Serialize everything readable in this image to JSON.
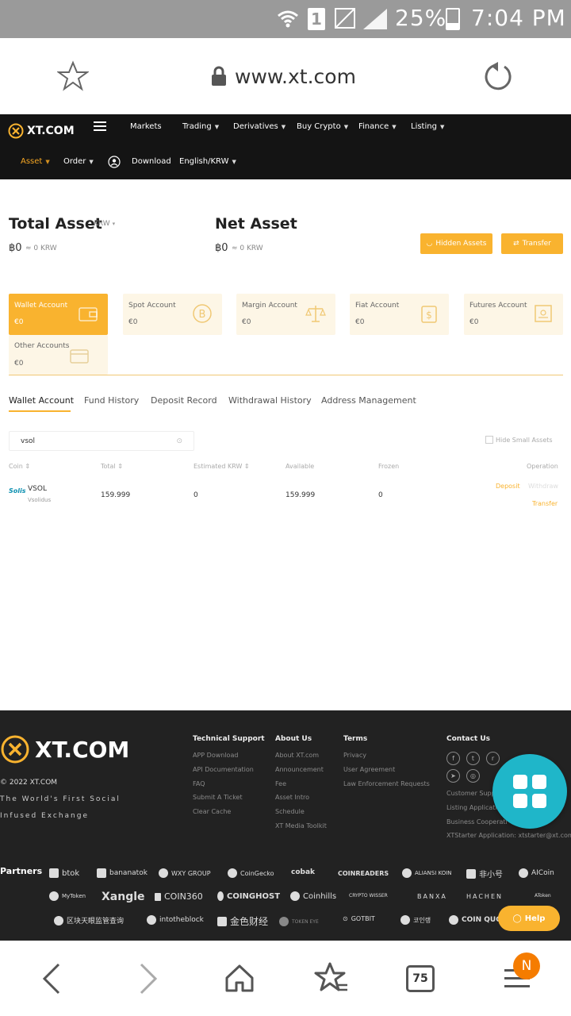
{
  "status_bar": {
    "battery": "25%",
    "time": "7:04 PM",
    "sim_label": "1"
  },
  "browser": {
    "url": "www.xt.com",
    "tabs_count": "75",
    "profile_initial": "N"
  },
  "header": {
    "logo": "XT.COM",
    "nav": [
      "Markets",
      "Trading",
      "Derivatives",
      "Buy Crypto",
      "Finance",
      "Listing"
    ],
    "subnav": [
      "Asset",
      "Order",
      "Download",
      "English/KRW"
    ]
  },
  "assets": {
    "total_title": "Total Asset",
    "total_currency": "KRW",
    "total_value": "฿0",
    "total_krw": "≈ 0 KRW",
    "net_title": "Net Asset",
    "net_value": "฿0",
    "net_krw": "≈ 0 KRW",
    "hidden_btn": "Hidden Assets",
    "transfer_btn": "Transfer"
  },
  "accounts": [
    {
      "label": "Wallet Account",
      "value": "€0"
    },
    {
      "label": "Spot Account",
      "value": "€0"
    },
    {
      "label": "Margin Account",
      "value": "€0"
    },
    {
      "label": "Fiat Account",
      "value": "€0"
    },
    {
      "label": "Futures Account",
      "value": "€0"
    },
    {
      "label": "Other Accounts",
      "value": "€0"
    }
  ],
  "tabs": [
    "Wallet Account",
    "Fund History",
    "Deposit Record",
    "Withdrawal History",
    "Address Management"
  ],
  "search": {
    "value": "vsol"
  },
  "hide_small": "Hide Small Assets",
  "table": {
    "headers": [
      "Coin",
      "Total",
      "Estimated KRW",
      "Available",
      "Frozen",
      "Operation"
    ],
    "rows": [
      {
        "coin": "VSOL",
        "name": "Vsolidus",
        "total": "159.999",
        "krw": "0",
        "available": "159.999",
        "frozen": "0",
        "deposit": "Deposit",
        "withdraw": "Withdraw",
        "transfer": "Transfer"
      }
    ]
  },
  "footer": {
    "logo": "XT.COM",
    "copyright": "© 2022 XT.COM",
    "slogan_1": "The World's First Social",
    "slogan_2": "Infused Exchange",
    "tech_title": "Technical Support",
    "tech": [
      "APP Download",
      "API Documentation",
      "FAQ",
      "Submit A Ticket",
      "Clear Cache"
    ],
    "about_title": "About Us",
    "about": [
      "About XT.com",
      "Announcement",
      "Fee",
      "Asset Intro",
      "Schedule",
      "XT Media Toolkit"
    ],
    "terms_title": "Terms",
    "terms": [
      "Privacy",
      "User Agreement",
      "Law Enforcement Requests"
    ],
    "contact_title": "Contact Us",
    "contact": [
      "Customer Supp",
      "Listing Applicati",
      "Business Cooperati",
      "XTStarter Application: xtstarter@xt.com"
    ],
    "partners_label": "Partners",
    "partners_row1": [
      "btok",
      "bananatok",
      "WXY GROUP",
      "CoinGecko",
      "cobak",
      "COINREADERS",
      "ALIANSI KOIN",
      "非小号",
      "AICoin"
    ],
    "partners_row2": [
      "MyToken",
      "Xangle",
      "COIN360",
      "COINGHOST",
      "Coinhills",
      "CRYPTO WISSER",
      "BANXA",
      "HACHEN",
      "AToken"
    ],
    "partners_row3": [
      "区块天眼监管查询",
      "intotheblock",
      "金色财经",
      "TOKEN EYE",
      "GOTBIT",
      "코인랭",
      "COIN QUO"
    ],
    "help": "Help"
  },
  "colors": {
    "accent": "#f9b32f",
    "nav_bg": "#141414",
    "footer_bg": "#222222",
    "fab": "#1fb6c9"
  }
}
